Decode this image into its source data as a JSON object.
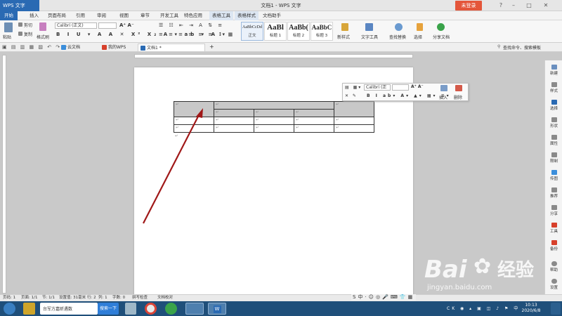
{
  "app": {
    "badge": "WPS 文字",
    "window_title": "文档1 - WPS 文字",
    "login_label": "未登录",
    "controls": [
      "?",
      "–",
      "□",
      "✕"
    ]
  },
  "menu": {
    "items": [
      "开始",
      "插入",
      "页面布局",
      "引用",
      "审阅",
      "视图",
      "章节",
      "开发工具",
      "特色应用",
      "表格工具",
      "表格样式",
      "文档助手"
    ]
  },
  "ribbon": {
    "paste": "粘贴",
    "cut": "剪切",
    "copy": "复制",
    "format_painter": "格式刷",
    "font_name": "Calibri (正文)",
    "font_size": "",
    "styles": [
      {
        "preview": "AaBbCcDd",
        "name": "正文"
      },
      {
        "preview": "AaBl",
        "name": "标题 1"
      },
      {
        "preview": "AaBb(",
        "name": "标题 2"
      },
      {
        "preview": "AaBbC",
        "name": "标题 3"
      }
    ],
    "new_style": "新样式",
    "text_tools": "文字工具",
    "find_replace": "查找替换",
    "select": "选择",
    "share_doc": "分享文档"
  },
  "tabs": {
    "cloud": "云文档",
    "my_wps": "我的WPS",
    "doc": "文档1 *",
    "add": "+",
    "search": "查找命令、搜索模板"
  },
  "table": {
    "rows": [
      [
        "↵",
        "↵",
        "↵"
      ],
      [
        "↵",
        "↵",
        "↵",
        "↵"
      ],
      [
        "↵",
        "↵",
        "↵",
        "↵",
        "↵"
      ],
      [
        "↵",
        "↵",
        "↵",
        "↵",
        "↵"
      ]
    ],
    "after": "↵"
  },
  "float_toolbar": {
    "font": "Calibri (正",
    "insert": "插入",
    "delete": "删除"
  },
  "right_panel": {
    "items": [
      "新建",
      "样式",
      "选择",
      "形状",
      "属性",
      "限制",
      "传图",
      "推荐",
      "分享",
      "工具",
      "备份",
      "帮助",
      "设置"
    ]
  },
  "status": {
    "page_num": "页码: 1",
    "pages": "页面: 1/1",
    "section": "节: 1/1",
    "setting": "设置值: 31毫米",
    "row": "行: 2",
    "col": "列: 1",
    "chars": "字数: 0",
    "spellcheck": "拼写检查",
    "proof": "文档校对"
  },
  "taskbar": {
    "search_hint": "台军方嘉昕遇数",
    "search_btn": "搜索一下",
    "time": "10:13",
    "date": "2020/6/8"
  },
  "watermark": {
    "brand": "Bai",
    "brand2": "经验",
    "url": "jingyan.baidu.com"
  },
  "colors": {
    "accent": "#2a6ab3",
    "login": "#e4563a",
    "arrow": "#a01818",
    "taskbar": "#1f4f7a"
  }
}
